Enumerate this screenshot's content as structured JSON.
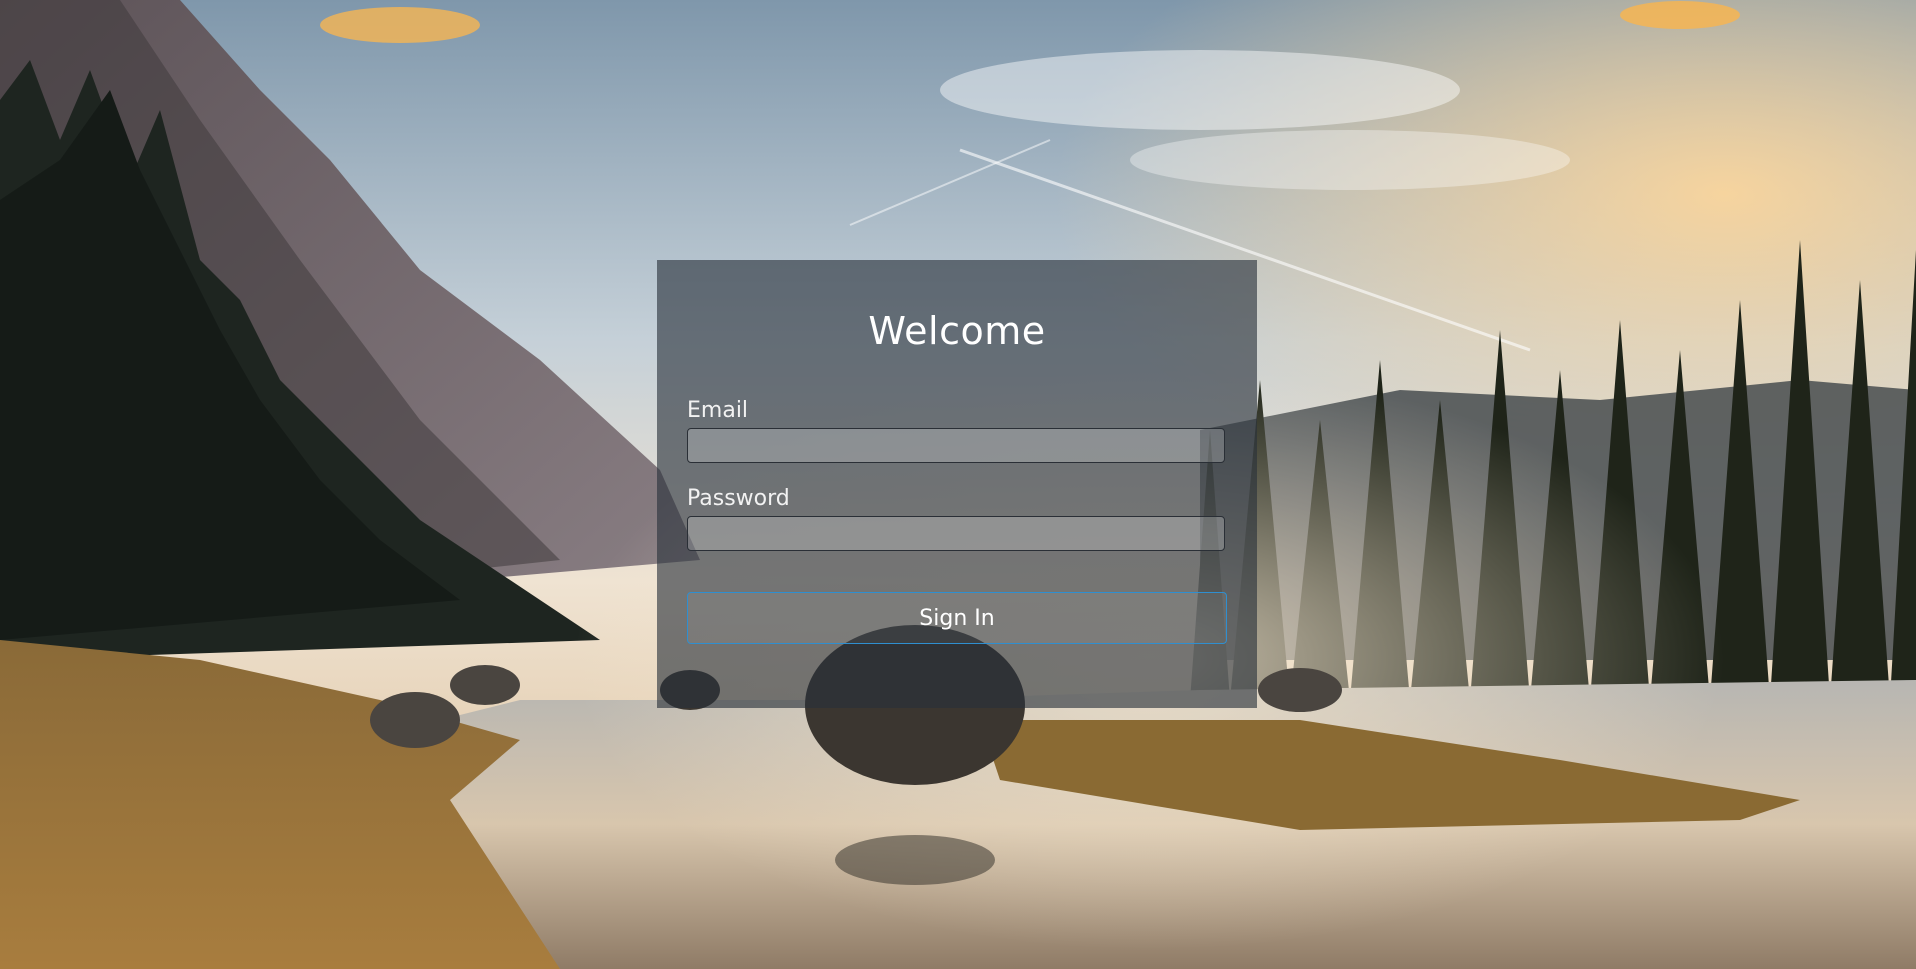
{
  "login": {
    "title": "Welcome",
    "email": {
      "label": "Email",
      "value": ""
    },
    "password": {
      "label": "Password",
      "value": ""
    },
    "submit_label": "Sign In"
  },
  "colors": {
    "card_overlay": "#28303a",
    "button_border": "#2f8fd0",
    "text": "#ffffff"
  }
}
